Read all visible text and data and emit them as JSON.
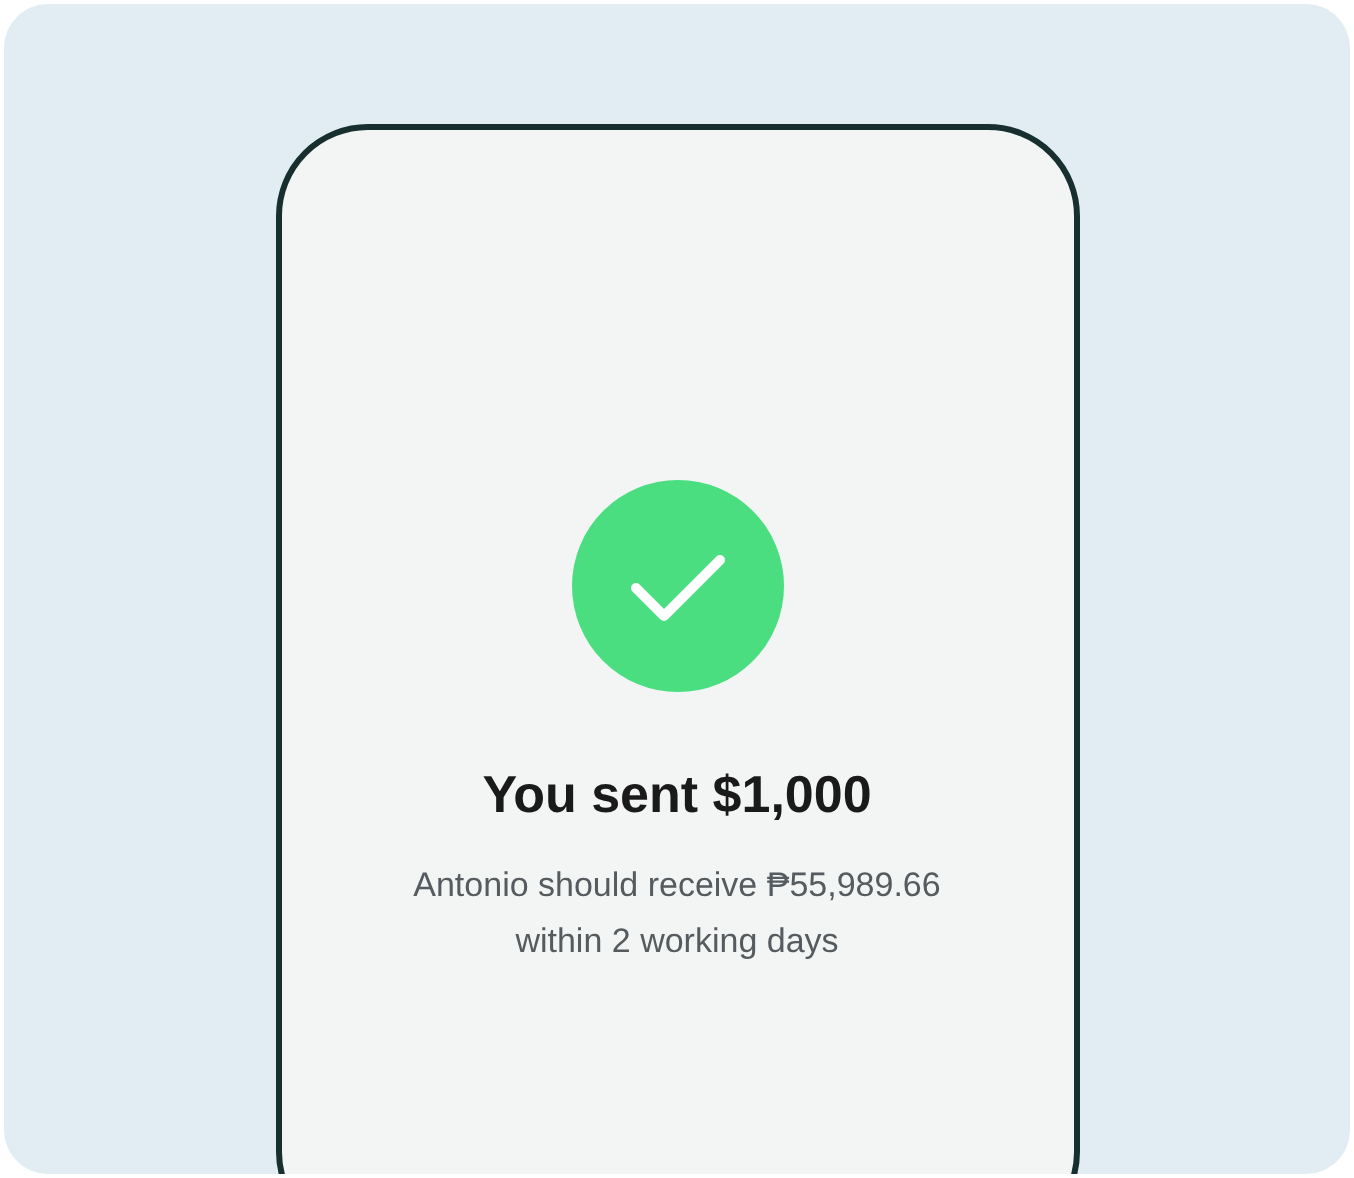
{
  "confirmation": {
    "title": "You sent $1,000",
    "message": "Antonio should receive ₱55,989.66 within 2 working days"
  }
}
